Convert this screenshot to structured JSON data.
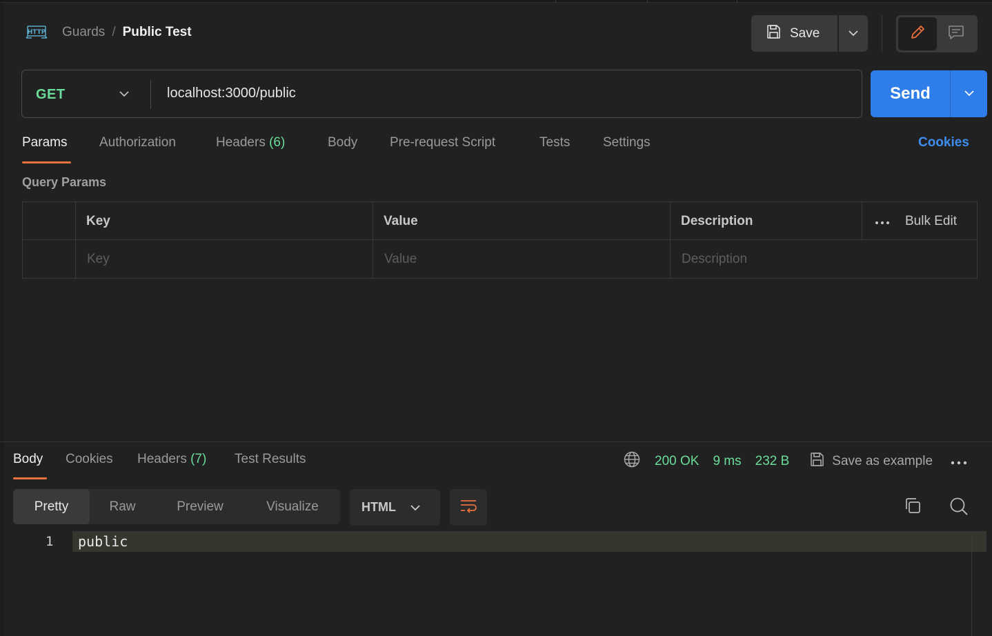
{
  "header": {
    "icon": "http-icon",
    "breadcrumb_parent": "Guards",
    "breadcrumb_separator": "/",
    "breadcrumb_current": "Public Test",
    "save_label": "Save"
  },
  "request": {
    "method": "GET",
    "url": "localhost:3000/public",
    "send_label": "Send"
  },
  "request_tabs": [
    {
      "label": "Params",
      "count": ""
    },
    {
      "label": "Authorization",
      "count": ""
    },
    {
      "label": "Headers",
      "count": "(6)"
    },
    {
      "label": "Body",
      "count": ""
    },
    {
      "label": "Pre-request Script",
      "count": ""
    },
    {
      "label": "Tests",
      "count": ""
    },
    {
      "label": "Settings",
      "count": ""
    }
  ],
  "cookies_link": "Cookies",
  "query_params": {
    "label": "Query Params",
    "headers": {
      "key": "Key",
      "value": "Value",
      "description": "Description"
    },
    "bulk_edit": "Bulk Edit",
    "placeholders": {
      "key": "Key",
      "value": "Value",
      "description": "Description"
    }
  },
  "response": {
    "tabs": [
      {
        "label": "Body",
        "count": ""
      },
      {
        "label": "Cookies",
        "count": ""
      },
      {
        "label": "Headers",
        "count": "(7)"
      },
      {
        "label": "Test Results",
        "count": ""
      }
    ],
    "status": "200 OK",
    "time": "9 ms",
    "size": "232 B",
    "save_example": "Save as example",
    "view_modes": [
      "Pretty",
      "Raw",
      "Preview",
      "Visualize"
    ],
    "format": "HTML",
    "code_lines": [
      {
        "number": "1",
        "text": "public"
      }
    ]
  },
  "colors": {
    "background": "#212121",
    "accent": "#e8713c",
    "send": "#2f7de8",
    "success": "#6bdd9a",
    "link": "#3d8ef0"
  }
}
